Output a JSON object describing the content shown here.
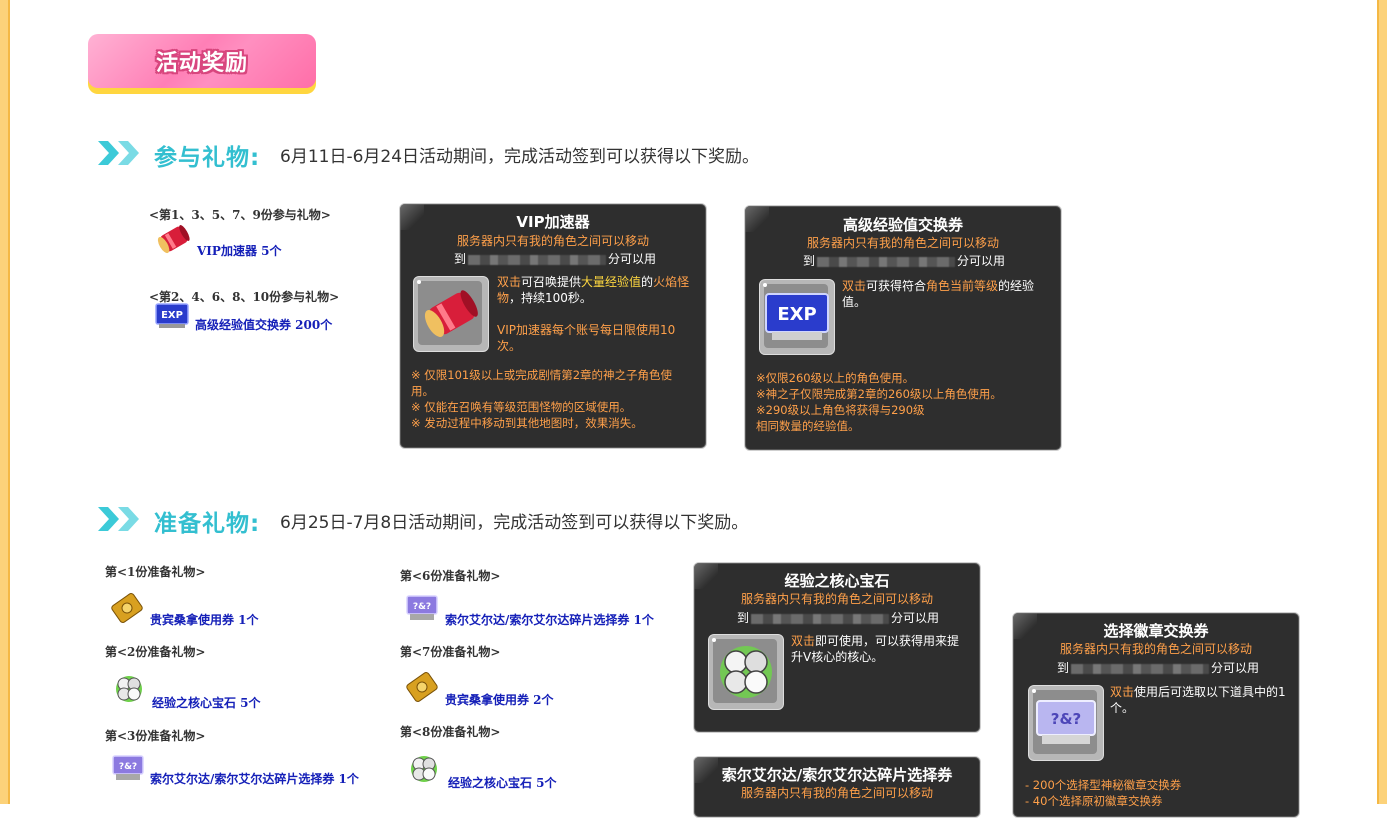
{
  "banner": {
    "title": "活动奖励"
  },
  "section1": {
    "title": "参与礼物:",
    "description": "6月11日-6月24日活动期间，完成活动签到可以获得以下奖励。",
    "groups": [
      {
        "label": "<第1、3、5、7、9份参与礼物>",
        "item": "VIP加速器 5个"
      },
      {
        "label": "<第2、4、6、8、10份参与礼物>",
        "item": "高级经验值交换券 200个"
      }
    ]
  },
  "card_vip": {
    "title": "VIP加速器",
    "subtitle": "服务器内只有我的角色之间可以移动",
    "until_prefix": "到",
    "until_suffix": "分可以用",
    "desc_parts": [
      "双击",
      "可召唤提供",
      "大量经验值",
      "的",
      "火焰怪物",
      "，持续100秒。"
    ],
    "desc2": "VIP加速器每个账号每日限使用10次。",
    "notes": [
      "※ 仅限101级以上或完成剧情第2章的神之子角色使用。",
      "※ 仅能在召唤有等级范围怪物的区域使用。",
      "※ 发动过程中移动到其他地图时，效果消失。"
    ]
  },
  "card_exp": {
    "title": "高级经验值交换券",
    "subtitle": "服务器内只有我的角色之间可以移动",
    "until_prefix": "到",
    "until_suffix": "分可以用",
    "desc_parts": [
      "双击",
      "可获得符合",
      "角色当前等级",
      "的经验值。"
    ],
    "notes": [
      "※仅限260级以上的角色使用。",
      "※神之子仅限完成第2章的260级以上角色使用。",
      "※290级以上角色将获得与290级",
      "相同数量的经验值。"
    ]
  },
  "section2": {
    "title": "准备礼物:",
    "description": "6月25日-7月8日活动期间，完成活动签到可以获得以下奖励。",
    "groups": [
      {
        "label": "第<1份准备礼物>",
        "item": "贵宾桑拿使用券 1个"
      },
      {
        "label": "第<2份准备礼物>",
        "item": "经验之核心宝石 5个"
      },
      {
        "label": "第<3份准备礼物>",
        "item": "索尔艾尔达/索尔艾尔达碎片选择券 1个"
      },
      {
        "label": "第<6份准备礼物>",
        "item": "索尔艾尔达/索尔艾尔达碎片选择券 1个"
      },
      {
        "label": "第<7份准备礼物>",
        "item": "贵宾桑拿使用券 2个"
      },
      {
        "label": "第<8份准备礼物>",
        "item": "经验之核心宝石 5个"
      }
    ]
  },
  "card_core": {
    "title": "经验之核心宝石",
    "subtitle": "服务器内只有我的角色之间可以移动",
    "until_prefix": "到",
    "until_suffix": "分可以用",
    "desc_parts": [
      "双击",
      "即可使用，可以获得用来提升V核心的核心。"
    ]
  },
  "card_sol": {
    "title": "索尔艾尔达/索尔艾尔达碎片选择券",
    "subtitle": "服务器内只有我的角色之间可以移动"
  },
  "card_badge": {
    "title": "选择徽章交换券",
    "subtitle": "服务器内只有我的角色之间可以移动",
    "until_prefix": "到",
    "until_suffix": "分可以用",
    "desc_parts": [
      "双击",
      "使用后可选取以下道具中的1个。"
    ],
    "notes": [
      "- 200个选择型神秘徽章交换券",
      "- 40个选择原初徽章交换券"
    ]
  },
  "colors": {
    "accent_cyan": "#33bfd0",
    "item_blue": "#1520b8",
    "card_bg": "#2e2e2e",
    "card_orange": "#ffa04a",
    "banner_pink": "#ff7fb6",
    "frame_yellow": "#fcd27a"
  }
}
